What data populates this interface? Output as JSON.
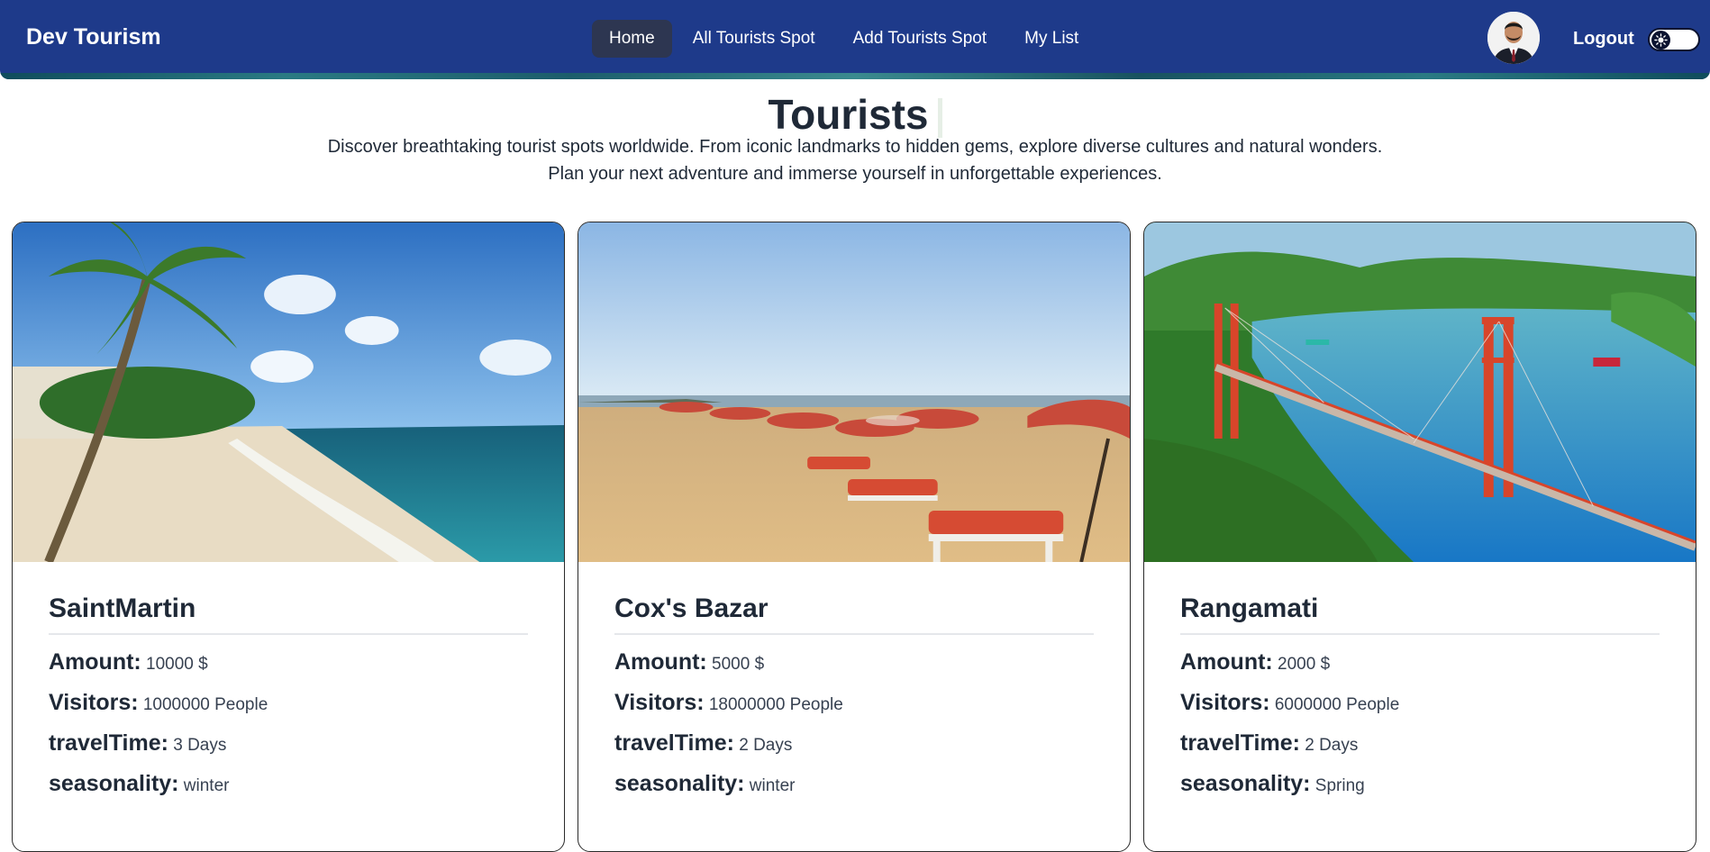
{
  "nav": {
    "brand": "Dev Tourism",
    "links": [
      "Home",
      "All Tourists Spot",
      "Add Tourists Spot",
      "My List"
    ],
    "logout": "Logout"
  },
  "hero": {
    "title": "Tourists",
    "intro_line1": "Discover breathtaking tourist spots worldwide. From iconic landmarks to hidden gems, explore diverse cultures and natural wonders.",
    "intro_line2": "Plan your next adventure and immerse yourself in unforgettable experiences."
  },
  "labels": {
    "amount": "Amount:",
    "visitors": "Visitors:",
    "travel_time": "travelTime:",
    "seasonality": "seasonality:"
  },
  "cards": [
    {
      "name": "SaintMartin",
      "amount": "10000 $",
      "visitors": "1000000 People",
      "travel_time": "3 Days",
      "seasonality": "winter"
    },
    {
      "name": "Cox's Bazar",
      "amount": "5000 $",
      "visitors": "18000000 People",
      "travel_time": "2 Days",
      "seasonality": "winter"
    },
    {
      "name": "Rangamati",
      "amount": "2000 $",
      "visitors": "6000000 People",
      "travel_time": "2 Days",
      "seasonality": "Spring"
    }
  ],
  "icons": {
    "avatar": "user-avatar",
    "theme": "sun-icon"
  },
  "colors": {
    "navbar": "#1e3a8a",
    "active_link": "#2d3651",
    "text": "#1f2937"
  }
}
